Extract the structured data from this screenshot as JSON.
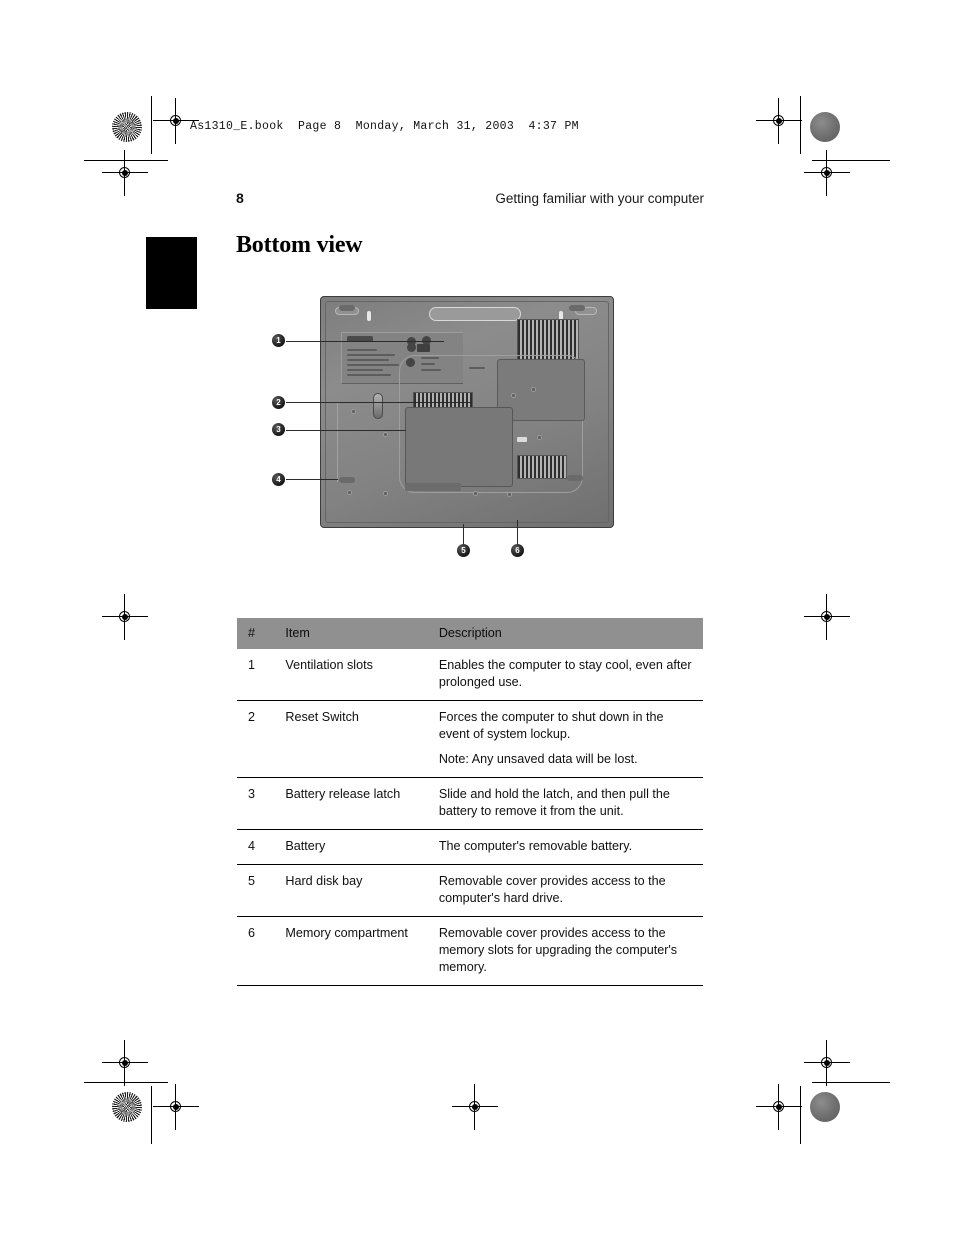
{
  "header": {
    "file_line": "As1310_E.book  Page 8  Monday, March 31, 2003  4:37 PM"
  },
  "running_head": {
    "page_number": "8",
    "title": "Getting familiar with your computer"
  },
  "section": {
    "title": "Bottom view"
  },
  "figure": {
    "alt": "Bottom view of notebook computer",
    "callouts": [
      "1",
      "2",
      "3",
      "4",
      "5",
      "6"
    ]
  },
  "table": {
    "headers": {
      "num": "#",
      "item": "Item",
      "description": "Description"
    },
    "rows": [
      {
        "num": "1",
        "item": "Ventilation slots",
        "description": "Enables the computer to stay cool, even after prolonged use.",
        "note": ""
      },
      {
        "num": "2",
        "item": "Reset Switch",
        "description": "Forces the computer to shut down in the event of system lockup.",
        "note": "Note: Any unsaved data will be lost."
      },
      {
        "num": "3",
        "item": "Battery release latch",
        "description": "Slide and hold the latch, and then pull the battery to remove it from the unit.",
        "note": ""
      },
      {
        "num": "4",
        "item": "Battery",
        "description": "The computer's removable battery.",
        "note": ""
      },
      {
        "num": "5",
        "item": "Hard disk bay",
        "description": "Removable cover provides access to the computer's hard drive.",
        "note": ""
      },
      {
        "num": "6",
        "item": "Memory compartment",
        "description": "Removable cover provides access to the memory slots for upgrading the computer's memory.",
        "note": ""
      }
    ]
  },
  "colors": {
    "table_header_bg": "#919090",
    "rule": "#000000",
    "chapter_tab": "#000000"
  }
}
